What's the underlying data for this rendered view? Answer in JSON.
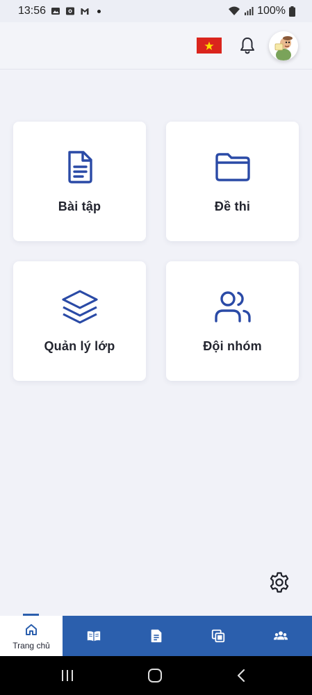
{
  "status_bar": {
    "time": "13:56",
    "battery": "100%",
    "icons": [
      "gallery-icon",
      "screen-record-icon",
      "gmail-icon",
      "wifi-icon",
      "signal-icon",
      "battery-icon"
    ]
  },
  "header": {
    "language_flag": "vietnam-flag",
    "icons": [
      "bell-icon",
      "avatar"
    ]
  },
  "cards": [
    {
      "label": "Bài tập",
      "icon": "document-icon"
    },
    {
      "label": "Đề thi",
      "icon": "folder-icon"
    },
    {
      "label": "Quản lý lớp",
      "icon": "layers-icon"
    },
    {
      "label": "Đội nhóm",
      "icon": "users-icon"
    }
  ],
  "bottom_nav": {
    "home_label": "Trang chủ",
    "items": [
      "home-icon",
      "book-icon",
      "document-icon",
      "copy-icon",
      "group-icon"
    ]
  },
  "colors": {
    "accent": "#2b5fad",
    "icon_blue": "#2a4aa6",
    "background": "#f1f2f8",
    "flag_red": "#da251d",
    "flag_star": "#ffde00"
  }
}
